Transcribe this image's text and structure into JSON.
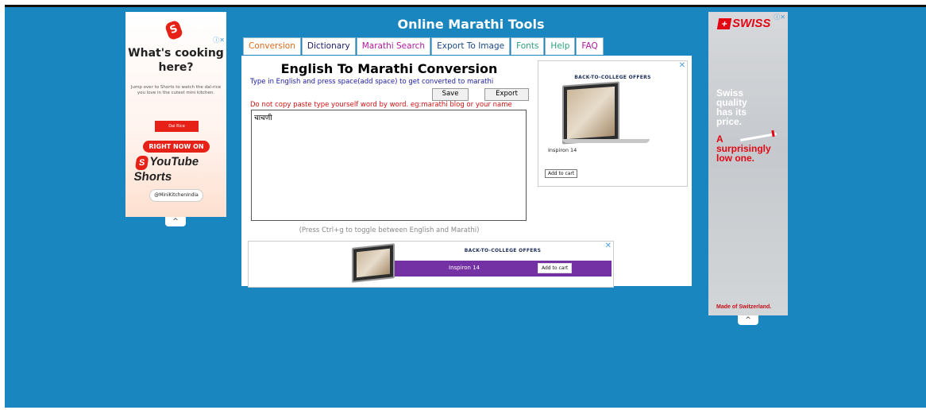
{
  "site_title": "Online Marathi Tools",
  "tabs": [
    {
      "label": "Conversion",
      "color": "#e06a1a"
    },
    {
      "label": "Dictionary",
      "color": "#1a1a6a"
    },
    {
      "label": "Marathi Search",
      "color": "#b01aa0"
    },
    {
      "label": "Export To Image",
      "color": "#1a4a8a"
    },
    {
      "label": "Fonts",
      "color": "#2aa07a"
    },
    {
      "label": "Help",
      "color": "#2aa07a"
    },
    {
      "label": "FAQ",
      "color": "#b01aa0"
    }
  ],
  "converter": {
    "title": "English To Marathi Conversion",
    "instruction": "Type in English and press space(add space) to get converted to marathi",
    "save_label": "Save",
    "export_label": "Export",
    "warning": "Do not copy paste type yourself word by word. eg:marathi blog or your name",
    "text_value": "चाचणी",
    "toggle_note": "(Press Ctrl+g to toggle between English and Marathi)"
  },
  "panel_ad": {
    "close": "✕",
    "headline": "BACK-TO-COLLEGE OFFERS",
    "product": "Inspiron 14",
    "cta": "Add to cart"
  },
  "banner_ad": {
    "close": "✕",
    "headline": "BACK-TO-COLLEGE OFFERS",
    "product": "Inspiron 14",
    "cta": "Add to cart"
  },
  "left_ad": {
    "logo_glyph": "S",
    "ad_info": "ⓘ✕",
    "headline_1": "What's cooking",
    "headline_2": "here?",
    "body": "Jump over to Shorts to watch the dal-rice you love in the cutest mini kitchen.",
    "red_box": "Dal Rice",
    "cta": "RIGHT NOW ON",
    "brand": "YouTube Shorts",
    "handle": "@MiniKitchenIndia",
    "collapse": "^"
  },
  "right_ad": {
    "ad_info": "ⓘ✕",
    "logo_cross": "+",
    "logo_text": "SWISS",
    "line_1": "Swiss",
    "line_2": "quality",
    "line_3": "has its",
    "line_4": "price.",
    "line_5": "A",
    "line_6": "surprisingly",
    "line_7": "low one.",
    "footer": "Made of Switzerland.",
    "collapse": "^"
  },
  "colors": {
    "page_bg": "#1a86bf",
    "warning": "#d01010",
    "instruction": "#1a1aa0",
    "swiss_red": "#e30613",
    "purple": "#7431a3"
  }
}
